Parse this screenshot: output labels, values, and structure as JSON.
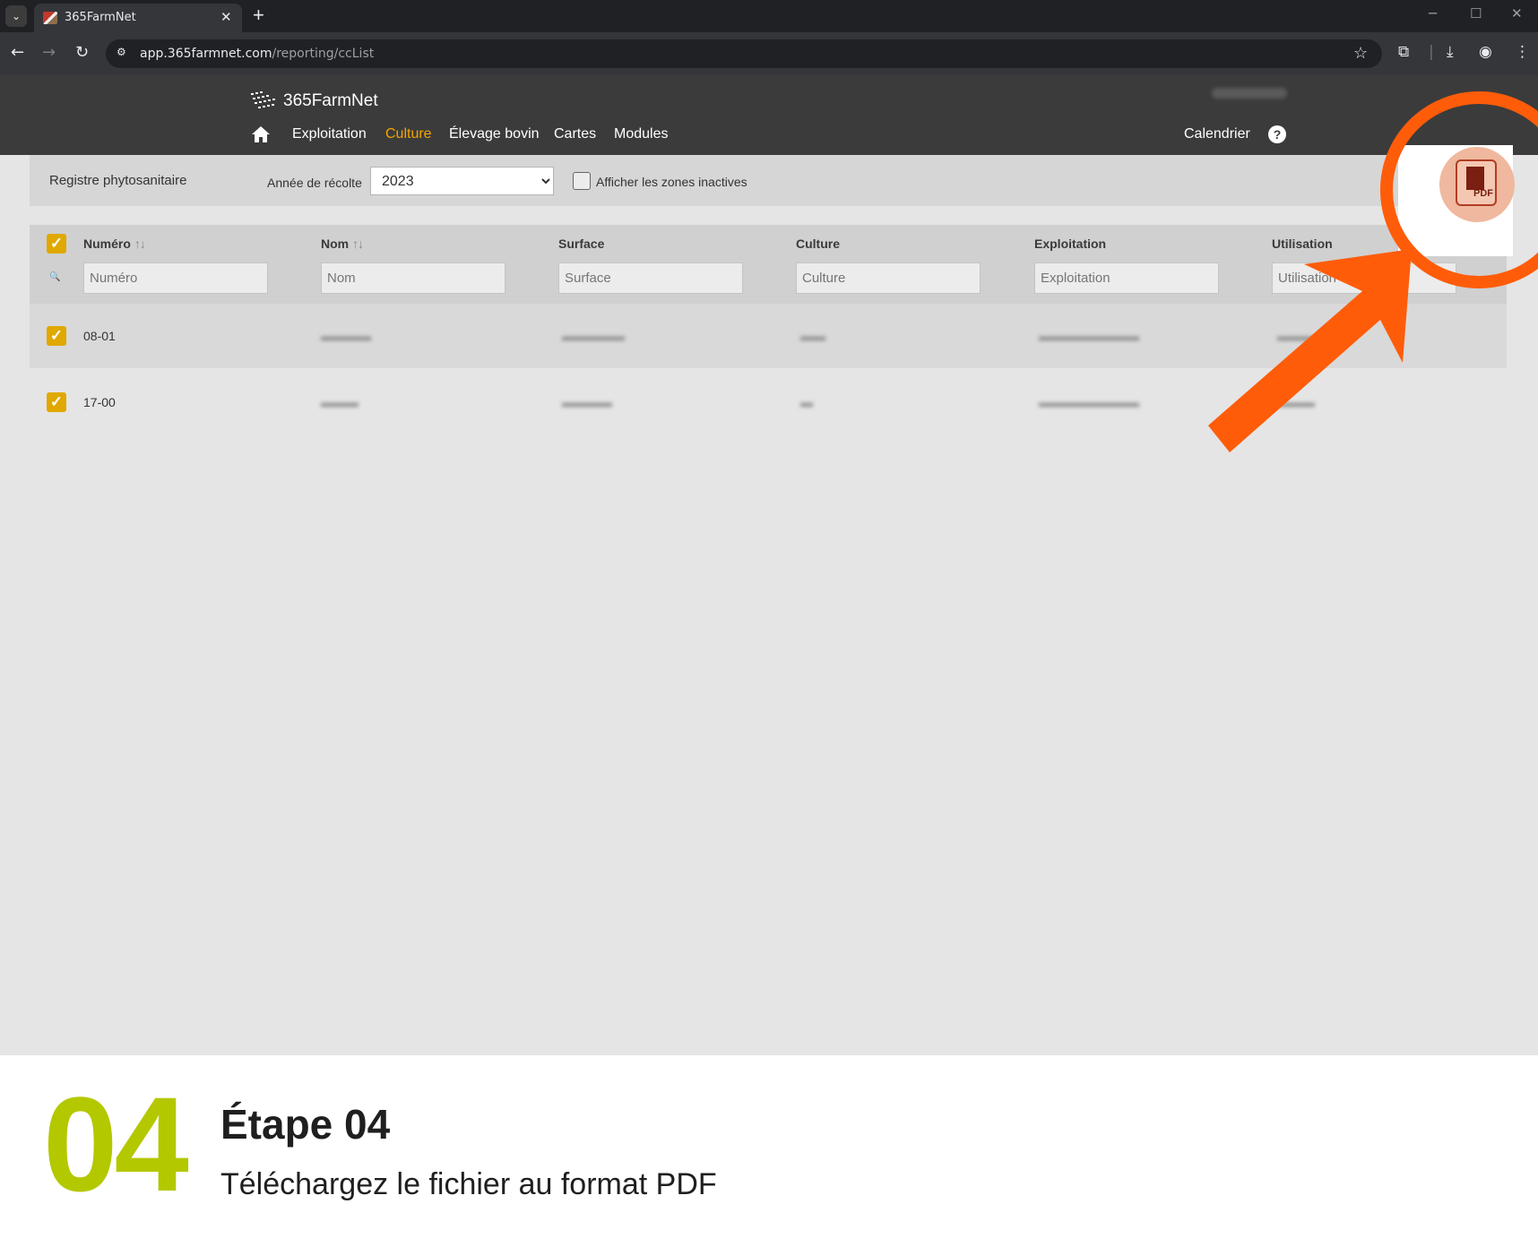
{
  "browser": {
    "tab_title": "365FarmNet",
    "url_host": "app.365farmnet.com",
    "url_path": "/reporting/ccList",
    "icons": [
      "tab-dropdown-icon",
      "close-icon",
      "new-tab-icon",
      "back-icon",
      "forward-icon",
      "reload-icon",
      "site-info-icon",
      "star-icon",
      "extensions-icon",
      "download-icon",
      "profile-icon",
      "menu-icon",
      "minimize-icon",
      "maximize-icon",
      "window-close-icon"
    ]
  },
  "app": {
    "logo_text": "365FarmNet",
    "nav": {
      "items": [
        "Exploitation",
        "Culture",
        "Élevage bovin",
        "Cartes",
        "Modules"
      ],
      "active": "Culture",
      "calendar": "Calendrier",
      "help": "?"
    }
  },
  "filters": {
    "title": "Registre phytosanitaire",
    "year_label": "Année de récolte",
    "year_value": "2023",
    "inactive_label": "Afficher les zones inactives",
    "inactive_checked": false
  },
  "table": {
    "columns": [
      {
        "label": "Numéro",
        "sortable": true,
        "placeholder": "Numéro"
      },
      {
        "label": "Nom",
        "sortable": true,
        "placeholder": "Nom"
      },
      {
        "label": "Surface",
        "sortable": false,
        "placeholder": "Surface"
      },
      {
        "label": "Culture",
        "sortable": false,
        "placeholder": "Culture"
      },
      {
        "label": "Exploitation",
        "sortable": false,
        "placeholder": "Exploitation"
      },
      {
        "label": "Utilisation",
        "sortable": false,
        "placeholder": "Utilisation"
      }
    ],
    "sort_glyph": "↑↓",
    "rows": [
      {
        "numero": "08-01",
        "checked": true
      },
      {
        "numero": "17-00",
        "checked": true
      }
    ]
  },
  "pdf_button": {
    "label": "PDF"
  },
  "colors": {
    "accent": "#f4a500",
    "checkbox": "#e0a800",
    "callout": "#ff5c0a",
    "step_number": "#b4c800"
  },
  "step": {
    "number": "04",
    "title": "Étape 04",
    "subtitle": "Téléchargez le fichier au format PDF"
  }
}
